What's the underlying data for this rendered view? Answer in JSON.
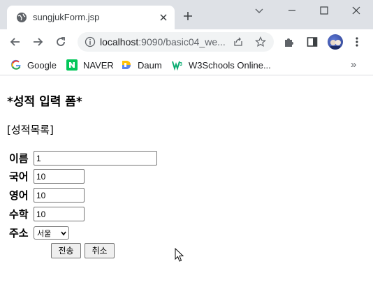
{
  "browser": {
    "tab_title": "sungjukForm.jsp",
    "url_host": "localhost",
    "url_rest": ":9090/basic04_we...",
    "bookmarks": [
      {
        "label": "Google",
        "icon": "google-icon"
      },
      {
        "label": "NAVER",
        "icon": "naver-icon"
      },
      {
        "label": "Daum",
        "icon": "daum-icon"
      },
      {
        "label": "W3Schools Online...",
        "icon": "w3schools-icon"
      }
    ],
    "more_bookmarks": "»"
  },
  "page": {
    "title": "*성적 입력 폼*",
    "list_link": "[성적목록]",
    "form": {
      "name": {
        "label": "이름",
        "value": "1"
      },
      "korean": {
        "label": "국어",
        "value": "10"
      },
      "english": {
        "label": "영어",
        "value": "10"
      },
      "math": {
        "label": "수학",
        "value": "10"
      },
      "address": {
        "label": "주소",
        "selected": "서울"
      },
      "submit_label": "전송",
      "reset_label": "취소"
    }
  },
  "colors": {
    "tabstrip": "#dee1e6",
    "omnibox": "#f1f3f4",
    "naver_green": "#03c75a",
    "w3_green": "#04aa6d"
  }
}
